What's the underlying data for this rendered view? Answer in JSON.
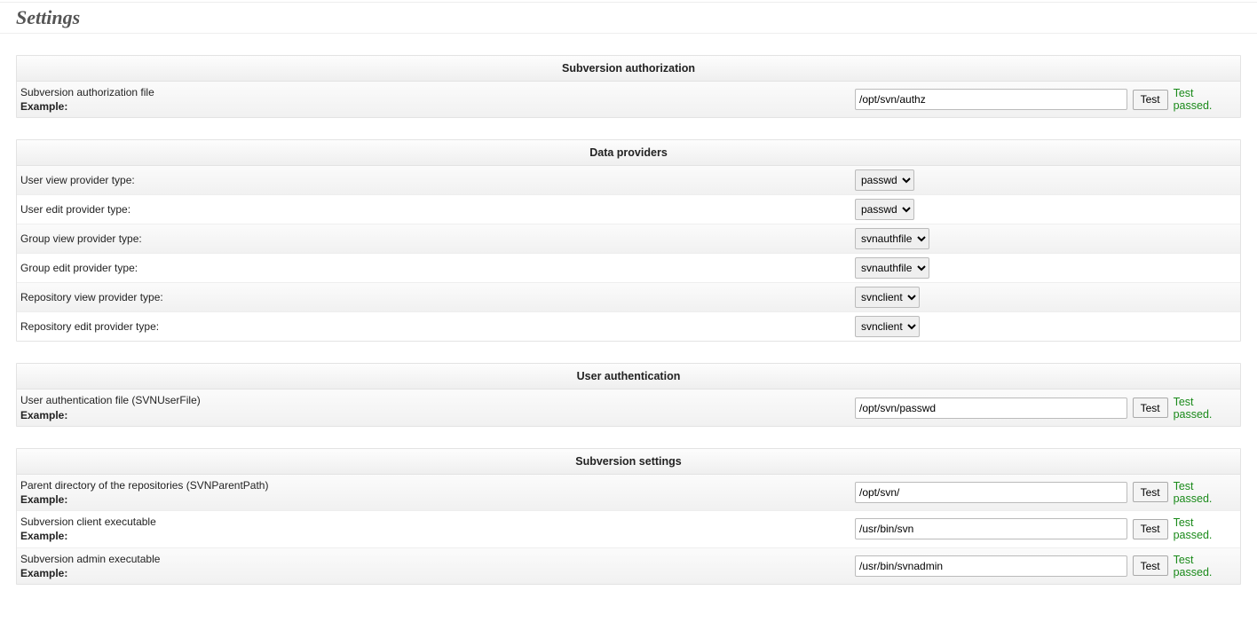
{
  "page": {
    "title": "Settings"
  },
  "common": {
    "exampleLabel": "Example:",
    "testButton": "Test",
    "testPassed": "Test passed."
  },
  "sections": {
    "svnauth": {
      "header": "Subversion authorization",
      "rows": {
        "authzFile": {
          "label": "Subversion authorization file",
          "value": "/opt/svn/authz"
        }
      }
    },
    "dataproviders": {
      "header": "Data providers",
      "rows": {
        "userView": {
          "label": "User view provider type:",
          "value": "passwd"
        },
        "userEdit": {
          "label": "User edit provider type:",
          "value": "passwd"
        },
        "groupView": {
          "label": "Group view provider type:",
          "value": "svnauthfile"
        },
        "groupEdit": {
          "label": "Group edit provider type:",
          "value": "svnauthfile"
        },
        "repoView": {
          "label": "Repository view provider type:",
          "value": "svnclient"
        },
        "repoEdit": {
          "label": "Repository edit provider type:",
          "value": "svnclient"
        }
      }
    },
    "userauth": {
      "header": "User authentication",
      "rows": {
        "userFile": {
          "label": "User authentication file (SVNUserFile)",
          "value": "/opt/svn/passwd"
        }
      }
    },
    "svnsettings": {
      "header": "Subversion settings",
      "rows": {
        "parentDir": {
          "label": "Parent directory of the repositories (SVNParentPath)",
          "value": "/opt/svn/"
        },
        "svnClient": {
          "label": "Subversion client executable",
          "value": "/usr/bin/svn"
        },
        "svnAdmin": {
          "label": "Subversion admin executable",
          "value": "/usr/bin/svnadmin"
        }
      }
    }
  }
}
